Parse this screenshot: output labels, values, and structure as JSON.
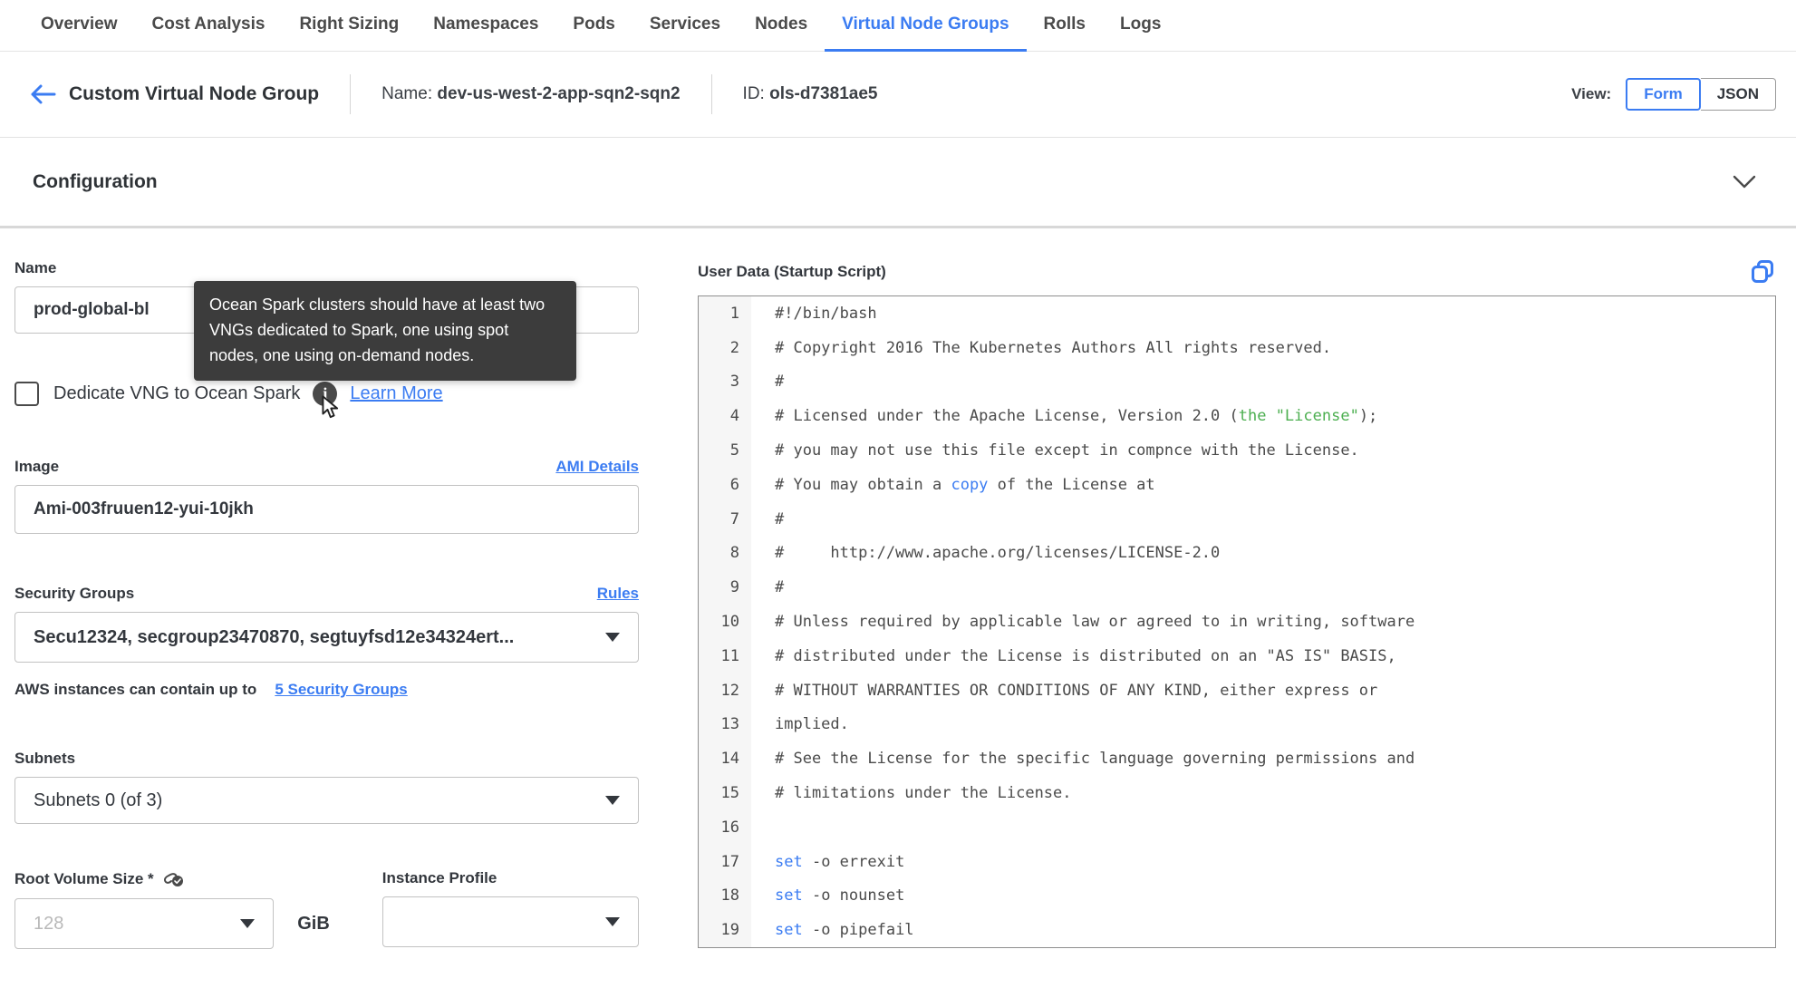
{
  "colors": {
    "accent": "#3b7cf2",
    "tooltip_bg": "#3c3c3c",
    "code_green": "#4caf50",
    "code_blue": "#3b7cf2"
  },
  "tabs": {
    "items": [
      "Overview",
      "Cost Analysis",
      "Right Sizing",
      "Namespaces",
      "Pods",
      "Services",
      "Nodes",
      "Virtual Node Groups",
      "Rolls",
      "Logs"
    ],
    "active": "Virtual Node Groups"
  },
  "header": {
    "title": "Custom Virtual Node Group",
    "name_label": "Name:",
    "name_value": "dev-us-west-2-app-sqn2-sqn2",
    "id_label": "ID:",
    "id_value": "ols-d7381ae5",
    "view_label": "View:",
    "view_options": [
      "Form",
      "JSON"
    ],
    "view_active": "Form"
  },
  "section": {
    "title": "Configuration"
  },
  "form": {
    "name": {
      "label": "Name",
      "value": "prod-global-bl"
    },
    "tooltip": {
      "text": "Ocean Spark clusters should have at least two VNGs dedicated to Spark, one using spot nodes, one using on-demand nodes."
    },
    "dedicate": {
      "label": "Dedicate VNG to Ocean Spark",
      "checked": false,
      "link": "Learn More"
    },
    "image": {
      "label": "Image",
      "link": "AMI Details",
      "value": "Ami-003fruuen12-yui-10jkh"
    },
    "security_groups": {
      "label": "Security Groups",
      "link": "Rules",
      "value": "Secu12324, secgroup23470870, segtuyfsd12e34324ert...",
      "helper_text": "AWS instances can contain up to",
      "helper_link": "5 Security Groups"
    },
    "subnets": {
      "label": "Subnets",
      "value": "Subnets 0 (of 3)"
    },
    "root_volume": {
      "label": "Root Volume Size *",
      "placeholder": "128",
      "unit": "GiB"
    },
    "instance_profile": {
      "label": "Instance Profile",
      "value": ""
    }
  },
  "user_data": {
    "title": "User Data (Startup Script)",
    "lines": [
      [
        {
          "t": "#!/bin/bash"
        }
      ],
      [
        {
          "t": "# Copyright 2016 The Kubernetes Authors All rights reserved."
        }
      ],
      [
        {
          "t": "#"
        }
      ],
      [
        {
          "t": "# Licensed under the Apache License, Version 2.0 ("
        },
        {
          "t": "the \"License\"",
          "c": "green"
        },
        {
          "t": ");"
        }
      ],
      [
        {
          "t": "# you may not use this file except in compnce with the License."
        }
      ],
      [
        {
          "t": "# You may obtain a "
        },
        {
          "t": "copy",
          "c": "blue"
        },
        {
          "t": " of the License at"
        }
      ],
      [
        {
          "t": "#"
        }
      ],
      [
        {
          "t": "#     http://www.apache.org/licenses/LICENSE-2.0"
        }
      ],
      [
        {
          "t": "#"
        }
      ],
      [
        {
          "t": "# Unless required by applicable law or agreed to in writing, software"
        }
      ],
      [
        {
          "t": "# distributed under the License is distributed on an \"AS IS\" BASIS,"
        }
      ],
      [
        {
          "t": "# WITHOUT WARRANTIES OR CONDITIONS OF ANY KIND, either express or"
        }
      ],
      [
        {
          "t": "implied."
        }
      ],
      [
        {
          "t": "# See the License for the specific language governing permissions and"
        }
      ],
      [
        {
          "t": "# limitations under the License."
        }
      ],
      [
        {
          "t": ""
        }
      ],
      [
        {
          "t": "set",
          "c": "blue"
        },
        {
          "t": " -o errexit"
        }
      ],
      [
        {
          "t": "set",
          "c": "blue"
        },
        {
          "t": " -o nounset"
        }
      ],
      [
        {
          "t": "set",
          "c": "blue"
        },
        {
          "t": " -o pipefail"
        }
      ]
    ]
  }
}
